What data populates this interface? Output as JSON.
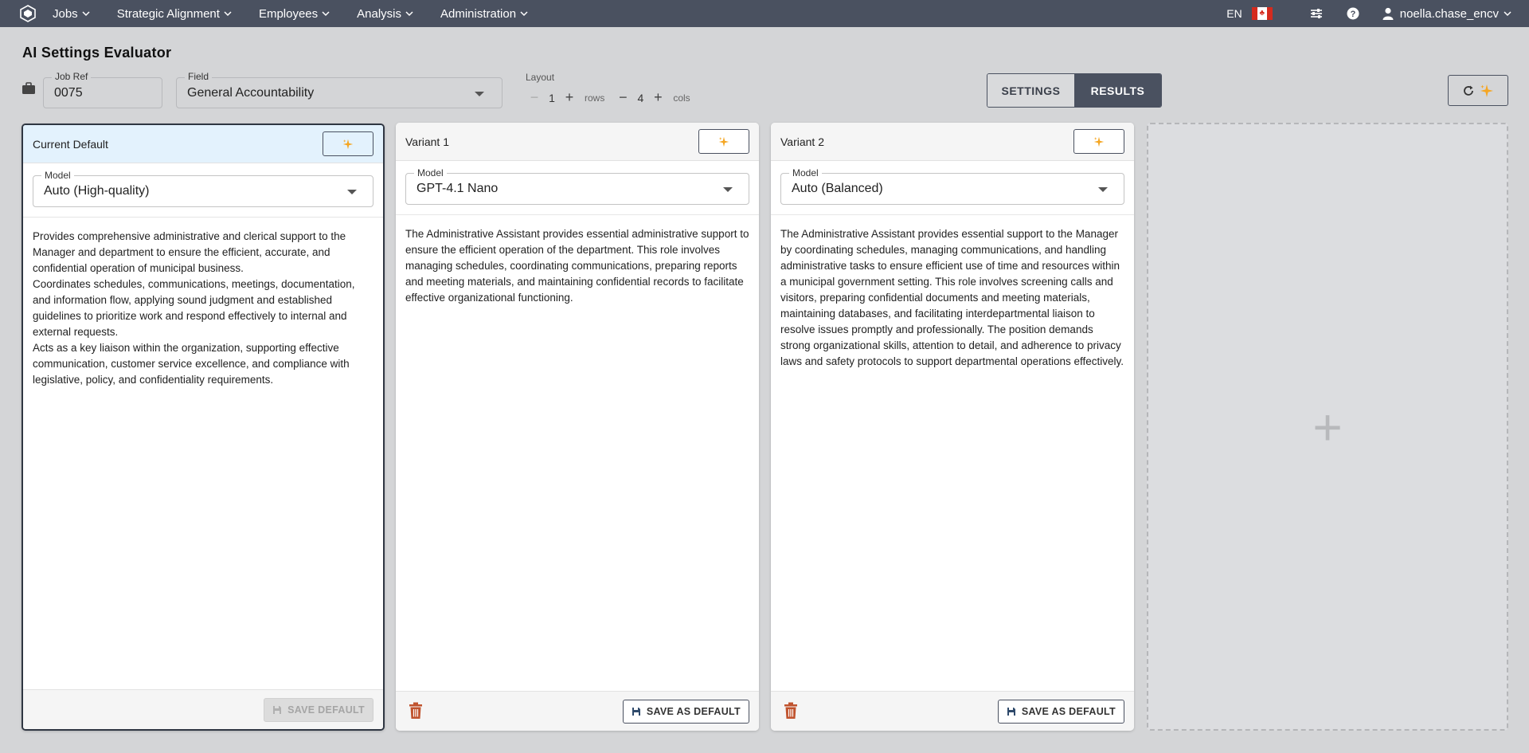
{
  "nav": {
    "items": [
      "Jobs",
      "Strategic Alignment",
      "Employees",
      "Analysis",
      "Administration"
    ],
    "language": "EN",
    "flag_icon": "canada-flag-icon",
    "user": "noella.chase_encv"
  },
  "page": {
    "title": "AI Settings Evaluator"
  },
  "toolbar": {
    "job_ref_label": "Job Ref",
    "job_ref_value": "0075",
    "field_label": "Field",
    "field_value": "General Accountability",
    "layout_label": "Layout",
    "rows_value": "1",
    "rows_unit": "rows",
    "cols_value": "4",
    "cols_unit": "cols",
    "settings_tab": "SETTINGS",
    "results_tab": "RESULTS",
    "active_tab": "RESULTS"
  },
  "cards": [
    {
      "title": "Current Default",
      "model_label": "Model",
      "model_value": "Auto (High-quality)",
      "paragraphs": [
        "Provides comprehensive administrative and clerical support to the Manager and department to ensure the efficient, accurate, and confidential operation of municipal business.",
        "Coordinates schedules, communications, meetings, documentation, and information flow, applying sound judgment and established guidelines to prioritize work and respond effectively to internal and external requests.",
        "Acts as a key liaison within the organization, supporting effective communication, customer service excellence, and compliance with legislative, policy, and confidentiality requirements."
      ],
      "save_label": "SAVE DEFAULT"
    },
    {
      "title": "Variant 1",
      "model_label": "Model",
      "model_value": "GPT-4.1 Nano",
      "paragraphs": [
        "The Administrative Assistant provides essential administrative support to ensure the efficient operation of the department. This role involves managing schedules, coordinating communications, preparing reports and meeting materials, and maintaining confidential records to facilitate effective organizational functioning."
      ],
      "save_label": "SAVE AS DEFAULT"
    },
    {
      "title": "Variant 2",
      "model_label": "Model",
      "model_value": "Auto (Balanced)",
      "paragraphs": [
        "The Administrative Assistant provides essential support to the Manager by coordinating schedules, managing communications, and handling administrative tasks to ensure efficient use of time and resources within a municipal government setting. This role involves screening calls and visitors, preparing confidential documents and meeting materials, maintaining databases, and facilitating interdepartmental liaison to resolve issues promptly and professionally. The position demands strong organizational skills, attention to detail, and adherence to privacy laws and safety protocols to support departmental operations effectively."
      ],
      "save_label": "SAVE AS DEFAULT"
    }
  ],
  "add_card": {
    "symbol": "+"
  },
  "colors": {
    "nav_bg": "#4a5160",
    "current_head": "#e3f2fd",
    "sparkle": "#f5a623",
    "trash": "#c0532e"
  }
}
